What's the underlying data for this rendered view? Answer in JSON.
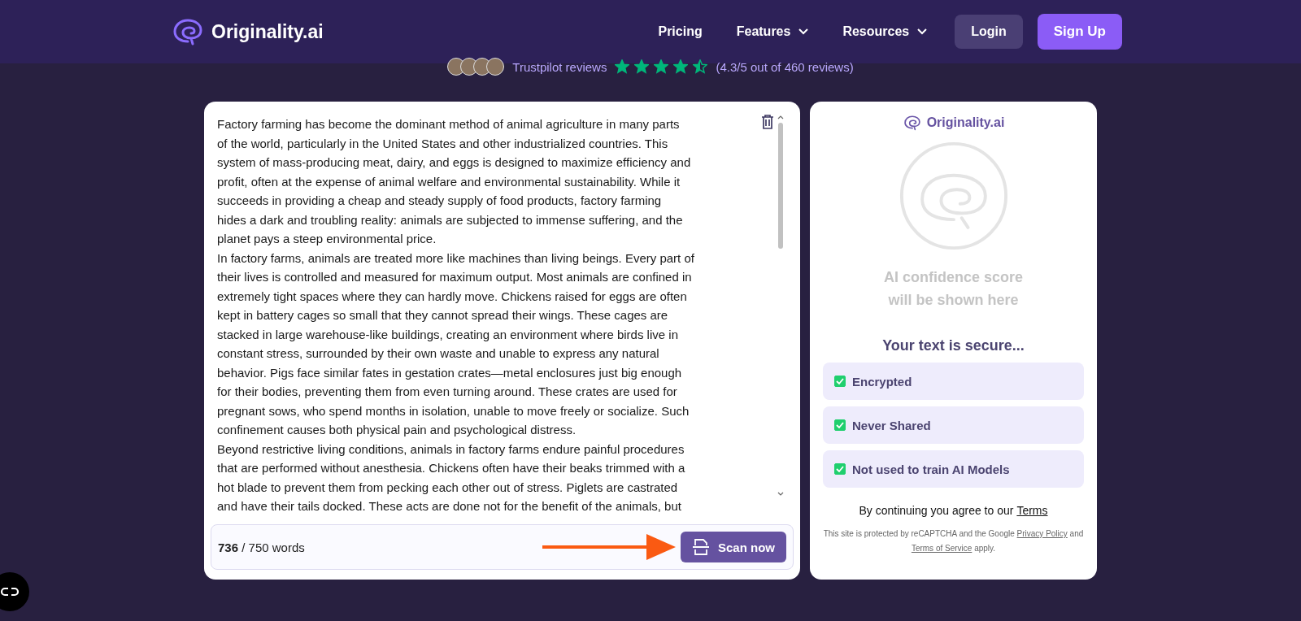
{
  "nav": {
    "brand": "Originality.ai",
    "links": [
      {
        "label": "Pricing",
        "dropdown": false
      },
      {
        "label": "Features",
        "dropdown": true
      },
      {
        "label": "Resources",
        "dropdown": true
      }
    ],
    "login": "Login",
    "signup": "Sign Up"
  },
  "reviews": {
    "label": "Trustpilot reviews",
    "stars": 4.5,
    "summary": "(4.3/5 out of 460 reviews)"
  },
  "editor": {
    "paragraphs": [
      {
        "lines": [
          "Factory farming has become the dominant method of animal agriculture in many parts",
          "of the world, particularly in the United States and other industrialized countries. This",
          "system of mass-producing meat, dairy, and eggs is designed to maximize efficiency and",
          "profit, often at the expense of animal welfare and environmental sustainability. While it",
          "succeeds in providing a cheap and steady supply of food products, factory farming",
          "hides a dark and troubling reality: animals are subjected to immense suffering, and the",
          "planet pays a steep environmental price."
        ]
      },
      {
        "lines": [
          "In factory farms, animals are treated more like machines than living beings. Every part of",
          "their lives is controlled and measured for maximum output. Most animals are confined in",
          "extremely tight spaces where they can hardly move. Chickens raised for eggs are often",
          "kept in battery cages so small that they cannot spread their wings. These cages are",
          "stacked in large warehouse-like buildings, creating an environment where birds live in",
          "constant stress, surrounded by their own waste and unable to express any natural",
          "behavior. Pigs face similar fates in gestation crates—metal enclosures just big enough",
          "for their bodies, preventing them from even turning around. These crates are used for",
          "pregnant sows, who spend months in isolation, unable to move freely or socialize. Such",
          "confinement causes both physical pain and psychological distress."
        ]
      },
      {
        "lines": [
          "Beyond restrictive living conditions, animals in factory farms endure painful procedures",
          "that are performed without anesthesia. Chickens often have their beaks trimmed with a",
          "hot blade to prevent them from pecking each other out of stress. Piglets are castrated",
          "and have their tails docked. These acts are done not for the benefit of the animals, but"
        ]
      }
    ],
    "word_count": "**736** / 750 words",
    "scan_button": "Scan now"
  },
  "result": {
    "brand": "Originality.ai",
    "score_message": [
      "AI confidence score",
      "will be shown here"
    ],
    "secure_title": "Your text is secure...",
    "items": [
      {
        "label": "Encrypted",
        "checked": true
      },
      {
        "label": "Never Shared",
        "checked": true
      },
      {
        "label": "Not used to train AI Models",
        "checked": true
      }
    ],
    "terms_text": "By continuing you agree to our",
    "terms_link": "Terms",
    "notice": {
      "before": "This site is protected by reCAPTCHA and the Google",
      "privacy": "Privacy Policy",
      "middle": "and",
      "tos": "Terms of Service",
      "after": "apply."
    }
  }
}
